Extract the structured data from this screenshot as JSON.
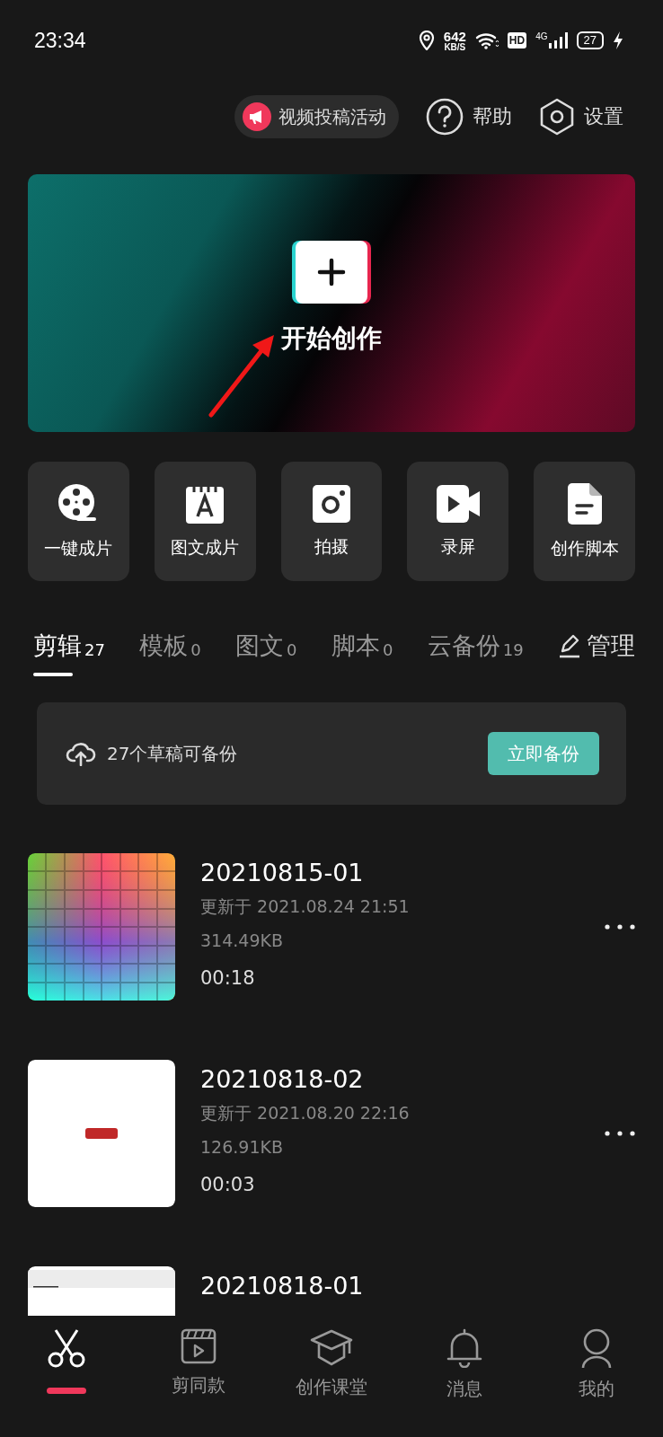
{
  "status_bar": {
    "time": "23:34",
    "speed": "642",
    "speed_unit": "KB/S",
    "hd": "HD",
    "network": "4G",
    "battery": "27"
  },
  "top_actions": [
    {
      "kind": "promo",
      "label": "视频投稿活动"
    },
    {
      "kind": "help",
      "label": "帮助"
    },
    {
      "kind": "settings",
      "label": "设置"
    }
  ],
  "hero": {
    "label": "开始创作"
  },
  "shortcuts": [
    {
      "kind": "reel",
      "label": "一键成片"
    },
    {
      "kind": "text",
      "label": "图文成片"
    },
    {
      "kind": "camera",
      "label": "拍摄"
    },
    {
      "kind": "record",
      "label": "录屏"
    },
    {
      "kind": "script",
      "label": "创作脚本"
    }
  ],
  "tabs": [
    {
      "label": "剪辑",
      "count": "27",
      "selected": true
    },
    {
      "label": "模板",
      "count": "0",
      "selected": false
    },
    {
      "label": "图文",
      "count": "0",
      "selected": false
    },
    {
      "label": "脚本",
      "count": "0",
      "selected": false
    },
    {
      "label": "云备份",
      "count": "19",
      "selected": false
    }
  ],
  "manage": "管理",
  "backup": {
    "text": "27个草稿可备份",
    "button": "立即备份"
  },
  "drafts": [
    {
      "title": "20210815-01",
      "updated": "更新于 2021.08.24 21:51",
      "size": "314.49KB",
      "duration": "00:18"
    },
    {
      "title": "20210818-02",
      "updated": "更新于 2021.08.20 22:16",
      "size": "126.91KB",
      "duration": "00:03"
    },
    {
      "title": "20210818-01"
    }
  ],
  "nav": [
    {
      "kind": "edit",
      "selected": true
    },
    {
      "kind": "template",
      "label": "剪同款",
      "selected": false
    },
    {
      "kind": "school",
      "label": "创作课堂",
      "selected": false
    },
    {
      "kind": "messages",
      "label": "消息",
      "selected": false
    },
    {
      "kind": "profile",
      "label": "我的",
      "selected": false
    }
  ]
}
